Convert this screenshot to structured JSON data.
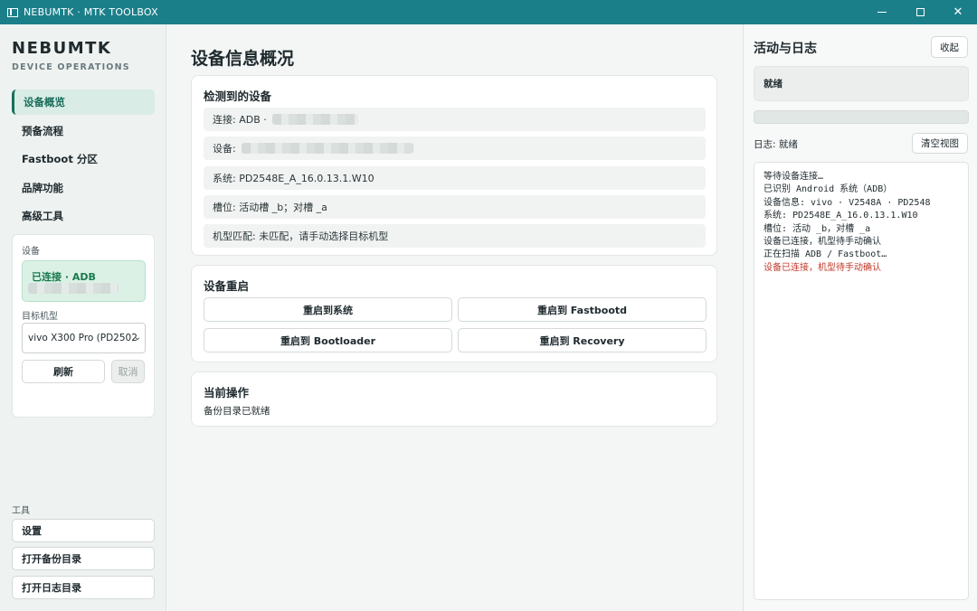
{
  "window": {
    "title": "NEBUMTK · MTK TOOLBOX",
    "icon": "app-window-icon",
    "controls": [
      "minimize-icon",
      "maximize-icon",
      "close-icon"
    ],
    "close_glyph": "✕"
  },
  "sidebar": {
    "brand": "NEBUMTK",
    "brand_sub": "DEVICE OPERATIONS",
    "items": [
      {
        "label": "设备概览",
        "active": true
      },
      {
        "label": "预备流程",
        "active": false
      },
      {
        "label": "Fastboot 分区",
        "active": false
      },
      {
        "label": "品牌功能",
        "active": false
      },
      {
        "label": "高级工具",
        "active": false
      }
    ],
    "device": {
      "section_label": "设备",
      "connection_status": "已连接 · ADB",
      "target_label": "目标机型",
      "target_value": "vivo X300 Pro (PD2502",
      "refresh_label": "刷新",
      "cancel_label": "取消"
    },
    "tools": {
      "section_label": "工具",
      "items": [
        "设置",
        "打开备份目录",
        "打开日志目录"
      ]
    }
  },
  "main": {
    "title": "设备信息概况",
    "detected": {
      "heading": "检测到的设备",
      "rows": [
        "连接: ADB ·",
        "设备:",
        "系统: PD2548E_A_16.0.13.1.W10",
        "槽位: 活动槽 _b；对槽 _a",
        "机型匹配: 未匹配，请手动选择目标机型"
      ]
    },
    "reboot": {
      "heading": "设备重启",
      "buttons": [
        "重启到系统",
        "重启到 Fastbootd",
        "重启到 Bootloader",
        "重启到 Recovery"
      ]
    },
    "current": {
      "heading": "当前操作",
      "text": "备份目录已就绪"
    }
  },
  "right": {
    "title": "活动与日志",
    "collapse_label": "收起",
    "status": "就绪",
    "progress": 0,
    "log_status": "日志: 就绪",
    "clear_label": "清空视图",
    "log_lines": [
      {
        "text": "等待设备连接…",
        "error": false
      },
      {
        "text": "已识别 Android 系统（ADB）",
        "error": false
      },
      {
        "text": "设备信息: vivo · V2548A · PD2548",
        "error": false
      },
      {
        "text": "系统: PD2548E_A_16.0.13.1.W10",
        "error": false
      },
      {
        "text": "槽位: 活动 _b，对槽 _a",
        "error": false
      },
      {
        "text": "设备已连接，机型待手动确认",
        "error": false
      },
      {
        "text": "正在扫描 ADB / Fastboot…",
        "error": false
      },
      {
        "text": "设备已连接，机型待手动确认",
        "error": true
      }
    ]
  },
  "colors": {
    "titlebar": "#1b7f8a",
    "accent": "#1a6e5b",
    "connected_bg": "#dcf1e6",
    "error": "#c0392b"
  }
}
